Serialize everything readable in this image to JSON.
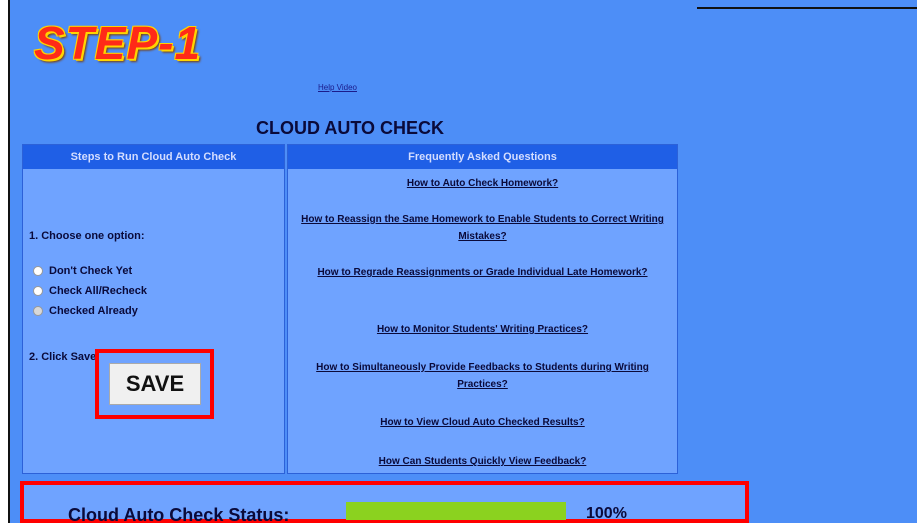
{
  "step_title": "STEP-1",
  "help_link": "Help Video",
  "main_title": "CLOUD AUTO CHECK",
  "left_panel": {
    "header": "Steps to Run Cloud Auto Check",
    "option_title": "1. Choose one option:",
    "options": [
      {
        "label": "Don't Check Yet",
        "checked": false
      },
      {
        "label": "Check All/Recheck",
        "checked": false
      },
      {
        "label": "Checked Already",
        "checked": true
      }
    ],
    "step2": "2. Click Save",
    "save_label": "SAVE"
  },
  "right_panel": {
    "header": "Frequently Asked Questions",
    "links": [
      "How to Auto Check Homework?",
      "How to Reassign the Same Homework to Enable Students to Correct Writing Mistakes?",
      "How to Regrade Reassignments or Grade Individual Late Homework?",
      "How to Monitor Students' Writing Practices?",
      "How to Simultaneously Provide Feedbacks to Students during Writing Practices?",
      "How to View Cloud Auto Checked Results?",
      "How Can Students Quickly View Feedback?"
    ]
  },
  "status": {
    "label": "Cloud Auto Check Status:",
    "progress_fraction": 1.0,
    "progress_text": "100%",
    "bar_color": "#8bd21f"
  },
  "colors": {
    "background": "#4d8ef7",
    "panel": "#6fa3ff",
    "header": "#1f5fe6",
    "highlight": "#ff0000"
  }
}
